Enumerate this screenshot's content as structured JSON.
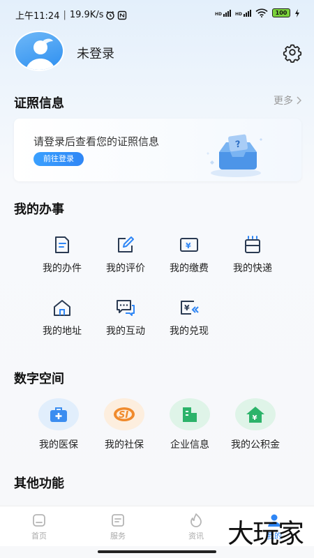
{
  "status_bar": {
    "time": "上午11:24",
    "speed": "19.9K/s",
    "signal1": "HD",
    "signal2": "HD",
    "battery": "100"
  },
  "profile": {
    "username": "未登录"
  },
  "cert_section": {
    "title": "证照信息",
    "more": "更多",
    "card_text": "请登录后查看您的证照信息",
    "login_button": "前往登录"
  },
  "affairs": {
    "title": "我的办事",
    "items": [
      {
        "label": "我的办件",
        "icon": "document-icon"
      },
      {
        "label": "我的评价",
        "icon": "edit-icon"
      },
      {
        "label": "我的缴费",
        "icon": "yuan-card-icon"
      },
      {
        "label": "我的快递",
        "icon": "package-icon"
      },
      {
        "label": "我的地址",
        "icon": "house-icon"
      },
      {
        "label": "我的互动",
        "icon": "chat-icon"
      },
      {
        "label": "我的兑现",
        "icon": "yuan-return-icon"
      }
    ]
  },
  "digital_space": {
    "title": "数字空间",
    "items": [
      {
        "label": "我的医保",
        "icon": "medical-kit-icon",
        "color": "#3b8df0",
        "bg": "#e1eefc"
      },
      {
        "label": "我的社保",
        "icon": "social-security-icon",
        "color": "#f08a2c",
        "bg": "#fdeede"
      },
      {
        "label": "企业信息",
        "icon": "building-icon",
        "color": "#2cb36a",
        "bg": "#dff4e8"
      },
      {
        "label": "我的公积金",
        "icon": "yuan-house-icon",
        "color": "#2cb36a",
        "bg": "#dff4e8"
      }
    ]
  },
  "other": {
    "title": "其他功能"
  },
  "tabbar": {
    "tabs": [
      {
        "label": "首页",
        "icon": "home-icon"
      },
      {
        "label": "服务",
        "icon": "service-icon"
      },
      {
        "label": "资讯",
        "icon": "news-icon"
      },
      {
        "label": "我的",
        "icon": "person-icon"
      }
    ]
  },
  "watermark": "大玩家",
  "colors": {
    "accent": "#2f86f5",
    "icon_stroke": "#2a3a52",
    "icon_accent": "#2f86f5"
  }
}
